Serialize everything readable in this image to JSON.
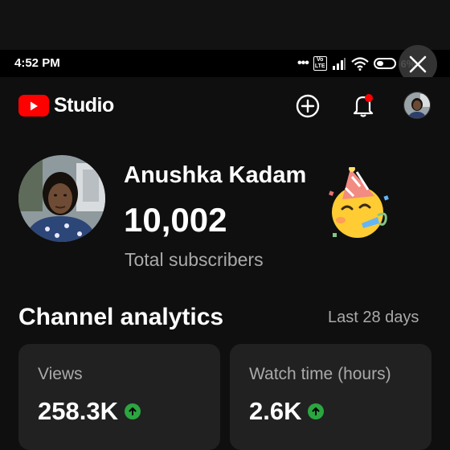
{
  "status_bar": {
    "time": "4:52 PM",
    "signal_dots": "•••",
    "volte_label": "Vo\nLTE",
    "battery_text": "6%"
  },
  "header": {
    "logo_text": "Studio"
  },
  "channel": {
    "name": "Anushka Kadam",
    "subscriber_count": "10,002",
    "subscriber_label": "Total subscribers"
  },
  "analytics": {
    "title": "Channel analytics",
    "range": "Last 28 days",
    "cards": [
      {
        "label": "Views",
        "value": "258.3K",
        "trend": "up"
      },
      {
        "label": "Watch time (hours)",
        "value": "2.6K",
        "trend": "up"
      }
    ]
  },
  "colors": {
    "brand_red": "#ff0000",
    "trend_green": "#2ba640",
    "background": "#0f0f0f",
    "card": "#212121",
    "secondary_text": "#aaaaaa"
  },
  "icons": {
    "close": "close-icon",
    "add": "add-icon",
    "bell": "notification-bell-icon",
    "party": "partying-face-emoji",
    "trend": "arrow-up-icon"
  }
}
